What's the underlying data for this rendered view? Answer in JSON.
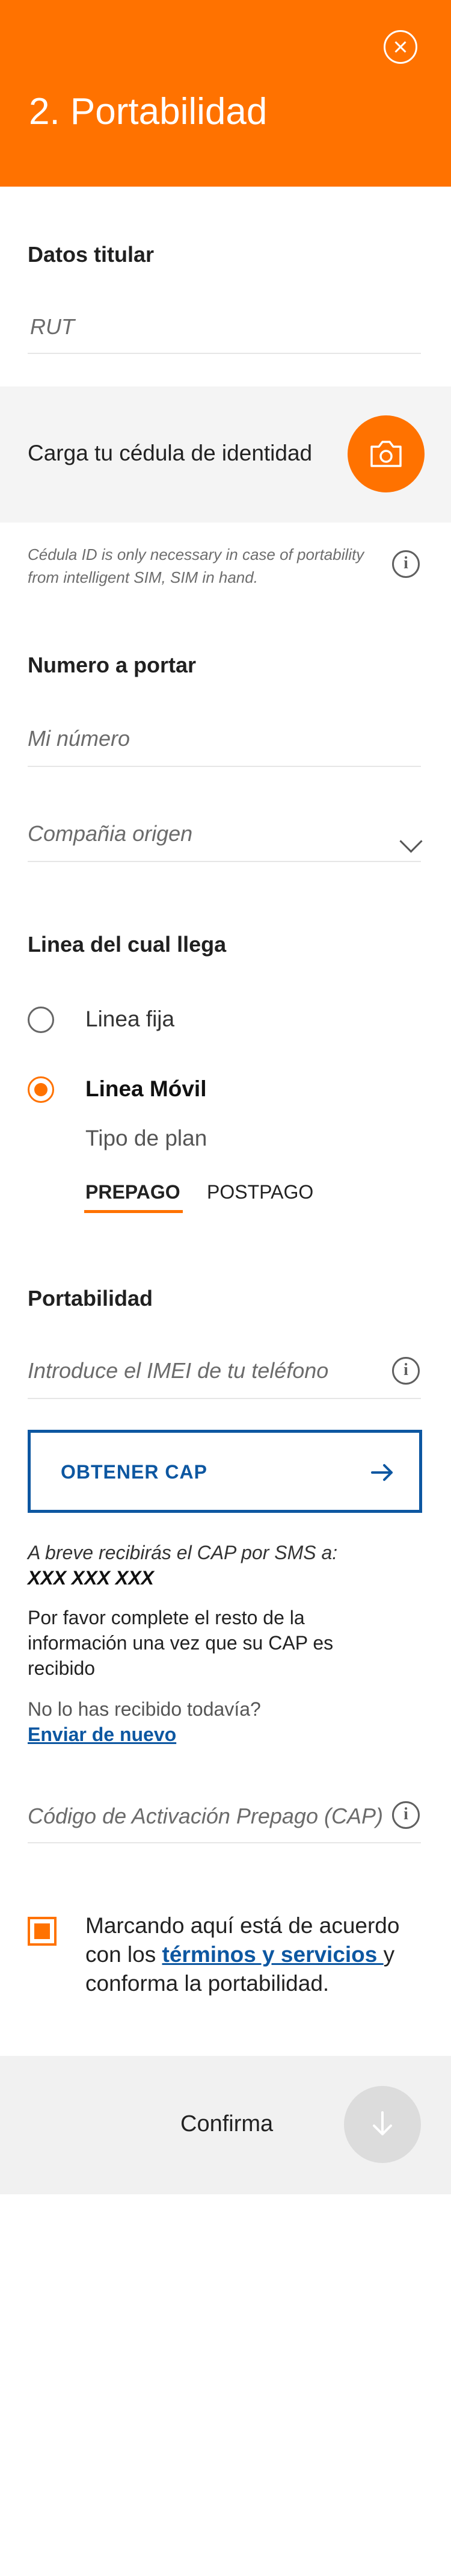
{
  "header": {
    "title": "2. Portabilidad",
    "close_icon": "close-icon",
    "bg_color": "#ff7200"
  },
  "datos_titular": {
    "title": "Datos titular",
    "rut_placeholder": "RUT"
  },
  "upload": {
    "label": "Carga tu cédula de identidad",
    "icon": "camera-icon",
    "note": "Cédula ID is only necessary in case of portability from intelligent SIM, SIM in hand.",
    "info_icon": "info-icon"
  },
  "numero": {
    "title": "Numero a portar",
    "number_placeholder": "Mi número",
    "company_placeholder": "Compañia origen"
  },
  "linea": {
    "title": "Linea del cual llega",
    "options": [
      {
        "label": "Linea fija",
        "selected": false
      },
      {
        "label": "Linea Móvil",
        "selected": true
      }
    ],
    "plan_label": "Tipo de plan",
    "tabs": [
      {
        "label": "PREPAGO",
        "active": true
      },
      {
        "label": "POSTPAGO",
        "active": false
      }
    ]
  },
  "portabilidad": {
    "title": "Portabilidad",
    "imei_placeholder": "Introduce el IMEI de tu teléfono",
    "cap_button": "OBTENER CAP",
    "sms_note": "A breve recibirás el CAP por SMS a:",
    "sms_number": "XXX XXX XXX",
    "instructions": "Por favor complete el resto de la información una vez que su CAP es recibido",
    "not_received": "No lo has recibido todavía?",
    "resend": "Enviar de nuevo",
    "cap_placeholder": "Código de Activación Prepago (CAP)"
  },
  "consent": {
    "checked": true,
    "text_before": "Marcando aquí está de acuerdo con los ",
    "link": "términos y servicios ",
    "text_after": "y conforma la portabilidad."
  },
  "footer": {
    "confirm": "Confirma",
    "arrow_icon": "arrow-down-icon"
  },
  "colors": {
    "accent": "#ff7200",
    "link": "#0d57a1"
  }
}
